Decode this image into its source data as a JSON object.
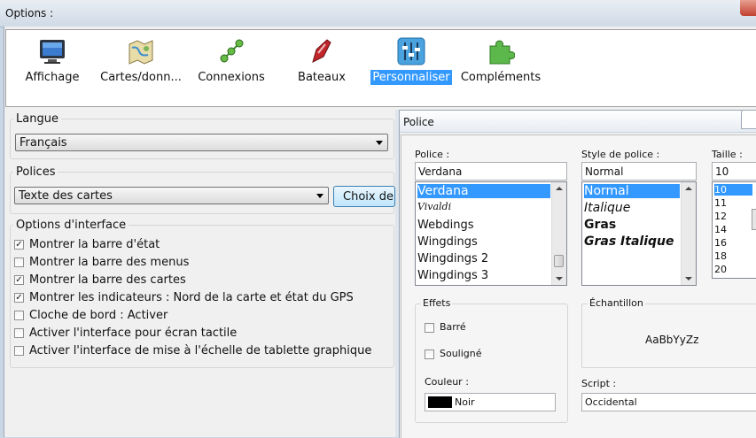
{
  "window": {
    "title": "Options :"
  },
  "toolbar": {
    "items": [
      {
        "label": "Affichage",
        "icon": "monitor-icon"
      },
      {
        "label": "Cartes/donn...",
        "icon": "map-icon"
      },
      {
        "label": "Connexions",
        "icon": "connections-icon"
      },
      {
        "label": "Bateaux",
        "icon": "boat-icon"
      },
      {
        "label": "Personnaliser",
        "icon": "sliders-icon",
        "selected": true
      },
      {
        "label": "Compléments",
        "icon": "puzzle-icon"
      }
    ]
  },
  "langue": {
    "title": "Langue",
    "value": "Français"
  },
  "polices": {
    "title": "Polices",
    "value": "Texte des cartes",
    "button": "Choix de"
  },
  "interface": {
    "title": "Options d'interface",
    "options": [
      {
        "label": "Montrer la barre d'état",
        "checked": true
      },
      {
        "label": "Montrer la barre des menus",
        "checked": false
      },
      {
        "label": "Montrer la barre des cartes",
        "checked": true
      },
      {
        "label": "Montrer les indicateurs : Nord de la carte et état du GPS",
        "checked": true
      },
      {
        "label": "Cloche de bord : Activer",
        "checked": false
      },
      {
        "label": "Activer l'interface pour écran tactile",
        "checked": false
      },
      {
        "label": "Activer l'interface de mise à l'échelle de tablette graphique",
        "checked": false
      }
    ]
  },
  "font_dialog": {
    "title": "Police",
    "police_label": "Police :",
    "police_value": "Verdana",
    "police_list": [
      "Verdana",
      "Vivaldi",
      "Webdings",
      "Wingdings",
      "Wingdings 2",
      "Wingdings 3"
    ],
    "style_label": "Style de police :",
    "style_value": "Normal",
    "style_list": [
      "Normal",
      "Italique",
      "Gras",
      "Gras Italique"
    ],
    "size_label": "Taille :",
    "size_value": "10",
    "size_list": [
      "10",
      "11",
      "12",
      "14",
      "16",
      "18",
      "20"
    ],
    "effects_title": "Effets",
    "strike_label": "Barré",
    "underline_label": "Souligné",
    "color_label": "Couleur :",
    "color_value": "Noir",
    "color_swatch": "#000000",
    "sample_title": "Échantillon",
    "sample_text": "AaBbYyZz",
    "script_label": "Script :",
    "script_value": "Occidental"
  },
  "colors": {
    "selection": "#3399ff"
  }
}
